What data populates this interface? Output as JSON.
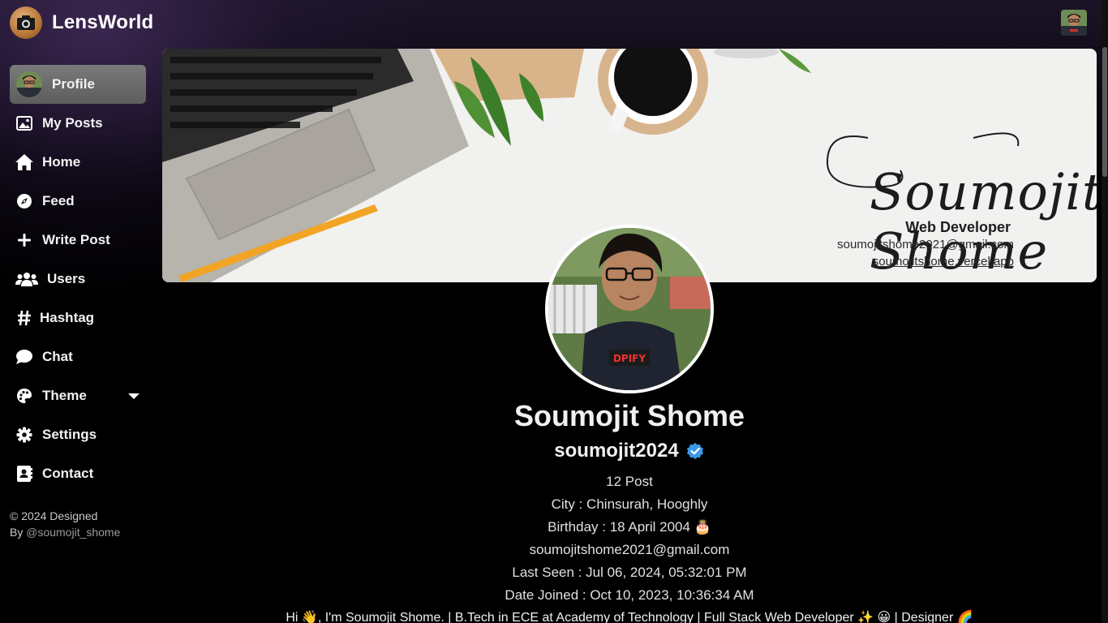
{
  "app": {
    "title": "LensWorld"
  },
  "sidebar": {
    "items": [
      {
        "label": "Profile",
        "icon": "avatar"
      },
      {
        "label": "My Posts",
        "icon": "image-icon"
      },
      {
        "label": "Home",
        "icon": "home-icon"
      },
      {
        "label": "Feed",
        "icon": "compass-icon"
      },
      {
        "label": "Write Post",
        "icon": "plus-icon"
      },
      {
        "label": "Users",
        "icon": "users-icon"
      },
      {
        "label": "Hashtag",
        "icon": "hashtag-icon"
      },
      {
        "label": "Chat",
        "icon": "chat-icon"
      },
      {
        "label": "Theme",
        "icon": "palette-icon"
      },
      {
        "label": "Settings",
        "icon": "gear-icon"
      },
      {
        "label": "Contact",
        "icon": "contact-icon"
      }
    ],
    "footer_line1": "© 2024 Designed",
    "footer_prefix": "By",
    "footer_handle": "@soumojit_shome"
  },
  "banner": {
    "signature": "Soumojit Shome",
    "role": "Web Developer",
    "email": "soumojitshome2021@gmail.com",
    "website": "soumojitshome.vercel.app"
  },
  "profile": {
    "name": "Soumojit Shome",
    "username": "soumojit2024",
    "posts": "12 Post",
    "city": "City : Chinsurah, Hooghly",
    "birthday": "Birthday : 18 April 2004 🎂",
    "email": "soumojitshome2021@gmail.com",
    "last_seen": "Last Seen : Jul 06, 2024, 05:32:01 PM",
    "date_joined": "Date Joined : Oct 10, 2023, 10:36:34 AM",
    "bio": "Hi 👋, I'm Soumojit Shome. | B.Tech in ECE at Academy of Technology | Full Stack Web Developer ✨ 😀 | Designer 🌈"
  },
  "colors": {
    "background": "#000000",
    "active_item": "#6a6a6a",
    "verified": "#3b9ae8"
  }
}
